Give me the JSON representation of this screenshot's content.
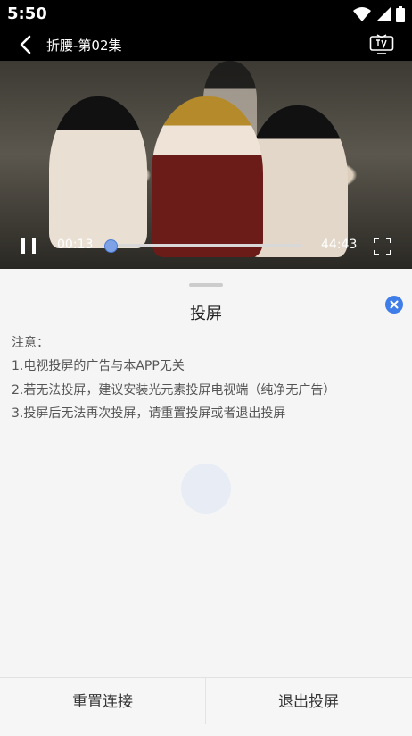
{
  "status_bar": {
    "time": "5:50",
    "icons": [
      "wifi-icon",
      "signal-icon",
      "battery-icon"
    ]
  },
  "header": {
    "title": "折腰-第02集",
    "back_icon": "back-arrow-icon",
    "cast_icon": "tv-icon"
  },
  "player": {
    "current_time": "00:13",
    "total_time": "44:43",
    "progress": 0.005,
    "accent": "#4a7bd8"
  },
  "cast_sheet": {
    "title": "投屏",
    "notes": [
      "注意：",
      "1.电视投屏的广告与本APP无关",
      "2.若无法投屏，建议安装光元素投屏电视端（纯净无广告）",
      "3.投屏后无法再次投屏，请重置投屏或者退出投屏"
    ],
    "close_color": "#3f7ee8"
  },
  "footer": {
    "reset_label": "重置连接",
    "exit_label": "退出投屏"
  }
}
